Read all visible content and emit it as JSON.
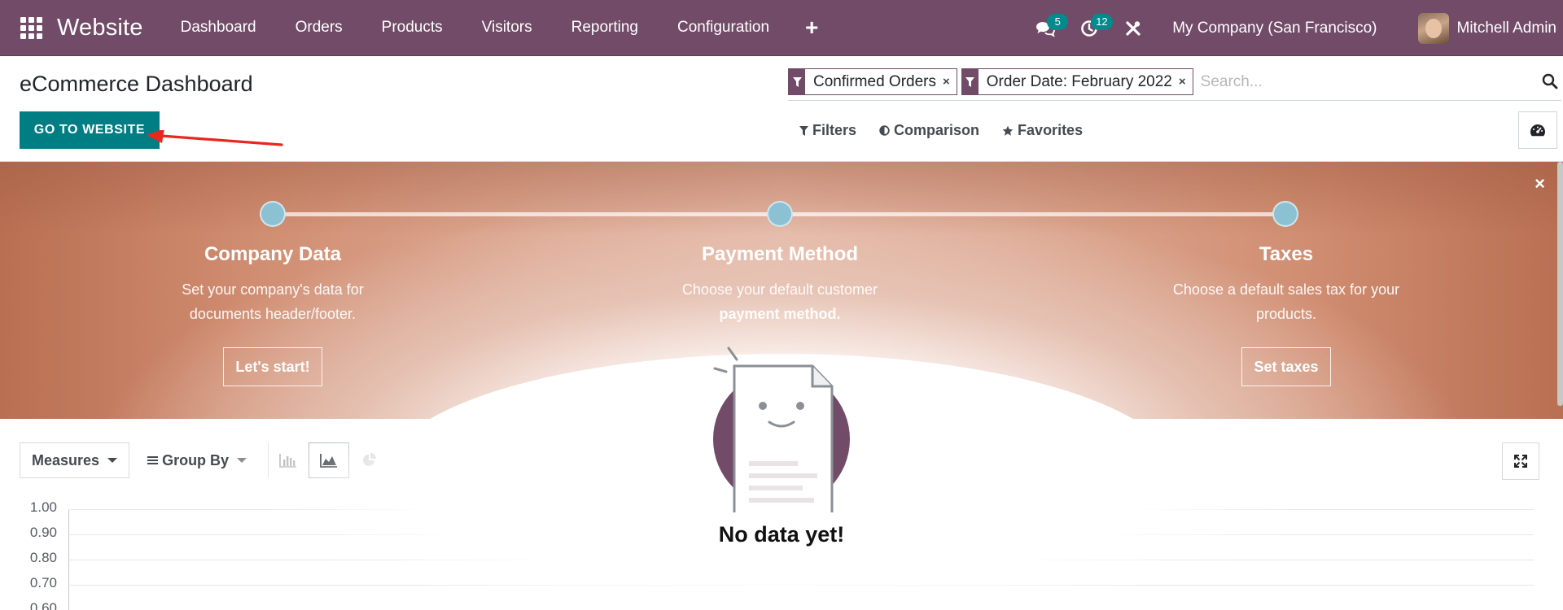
{
  "navbar": {
    "app_name": "Website",
    "menu": [
      "Dashboard",
      "Orders",
      "Products",
      "Visitors",
      "Reporting",
      "Configuration"
    ],
    "plus_label": "+",
    "messages_count": "5",
    "activities_count": "12",
    "company": "My Company (San Francisco)",
    "user": "Mitchell Admin"
  },
  "control_panel": {
    "title": "eCommerce Dashboard",
    "primary_button": "GO TO WEBSITE",
    "facets": [
      {
        "label": "Confirmed Orders",
        "remove": "×"
      },
      {
        "label": "Order Date: February 2022",
        "remove": "×"
      }
    ],
    "search_placeholder": "Search...",
    "filters_label": "Filters",
    "comparison_label": "Comparison",
    "favorites_label": "Favorites"
  },
  "onboarding": {
    "close": "×",
    "steps": [
      {
        "title": "Company Data",
        "desc1": "Set your company's data for",
        "desc2": "documents header/footer.",
        "button": "Let's start!"
      },
      {
        "title": "Payment Method",
        "desc1": "Choose your default customer",
        "desc2": "payment method.",
        "button": ""
      },
      {
        "title": "Taxes",
        "desc1": "Choose a default sales tax for your",
        "desc2": "products.",
        "button": "Set taxes"
      }
    ]
  },
  "graph": {
    "measures_label": "Measures",
    "groupby_label": "Group By",
    "active_chart_type": "line",
    "y_ticks": [
      "1.00",
      "0.90",
      "0.80",
      "0.70",
      "0.60"
    ],
    "no_data_text": "No data yet!"
  },
  "colors": {
    "brand": "#714b67",
    "primary_button": "#017e84",
    "badge": "#018b8d",
    "step_dot": "#8cc1d3",
    "annotation_arrow": "#e8281e"
  }
}
